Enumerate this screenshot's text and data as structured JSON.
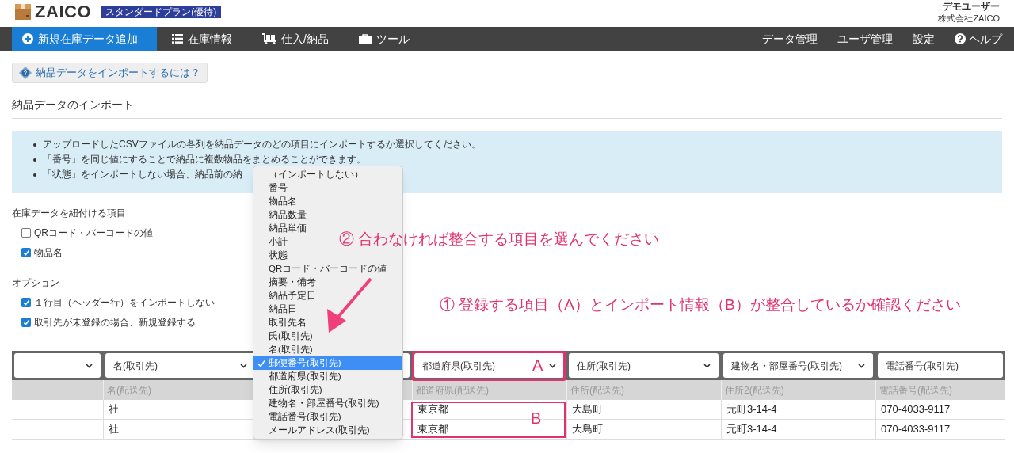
{
  "header": {
    "logo_text": "ZAICO",
    "plan_badge": "スタンダードプラン(優待)",
    "user_name": "デモユーザー",
    "company": "株式会社ZAICO"
  },
  "nav": {
    "left": [
      {
        "label": "新規在庫データ追加",
        "selected": true
      },
      {
        "label": "在庫情報",
        "selected": false
      },
      {
        "label": "仕入/納品",
        "selected": false
      },
      {
        "label": "ツール",
        "selected": false
      }
    ],
    "right": [
      {
        "label": "データ管理"
      },
      {
        "label": "ユーザ管理"
      },
      {
        "label": "設定"
      },
      {
        "label": "ヘルプ"
      }
    ]
  },
  "help_button": "納品データをインポートするには？",
  "section_title": "納品データのインポート",
  "info_bullets": [
    "アップロードしたCSVファイルの各列を納品データのどの項目にインポートするか選択してください。",
    "「番号」を同じ値にすることで納品に複数物品をまとめることができます。",
    "「状態」をインポートしない場合、納品前の納"
  ],
  "link_fields": {
    "title": "在庫データを紐付ける項目",
    "options": [
      {
        "label": "QRコード・バーコードの値",
        "checked": false
      },
      {
        "label": "物品名",
        "checked": true
      }
    ]
  },
  "options": {
    "title": "オプション",
    "options": [
      {
        "label": "１行目（ヘッダー行）をインポートしない",
        "checked": true
      },
      {
        "label": "取引先が未登録の場合、新規登録する",
        "checked": true
      }
    ]
  },
  "mapping_table": {
    "columns": [
      {
        "cells": [
          "",
          ""
        ]
      },
      {
        "select_value": "名(取引先)",
        "header": "名(配送先)",
        "cells": [
          "社",
          "社"
        ]
      },
      {
        "cells": [
          "",
          ""
        ]
      },
      {
        "select_value": "都道府県(取引先)",
        "header": "都道府県(配送先)",
        "cells": [
          "東京都",
          "東京都"
        ]
      },
      {
        "select_value": "住所(取引先)",
        "header": "住所(配送先)",
        "cells": [
          "大島町",
          "大島町"
        ]
      },
      {
        "select_value": "建物名・部屋番号(取引先)",
        "header": "住所2(配送先)",
        "cells": [
          "元町3-14-4",
          "元町3-14-4"
        ]
      },
      {
        "select_value": "電話番号(取引先)",
        "header": "電話番号(配送先)",
        "cells": [
          "070-4033-9117",
          "070-4033-9117"
        ]
      }
    ]
  },
  "dropdown": {
    "options": [
      {
        "label": "（インポートしない）",
        "selected": false
      },
      {
        "label": "番号",
        "selected": false
      },
      {
        "label": "物品名",
        "selected": false
      },
      {
        "label": "納品数量",
        "selected": false
      },
      {
        "label": "納品単価",
        "selected": false
      },
      {
        "label": "小計",
        "selected": false
      },
      {
        "label": "状態",
        "selected": false
      },
      {
        "label": "QRコード・バーコードの値",
        "selected": false
      },
      {
        "label": "摘要・備考",
        "selected": false
      },
      {
        "label": "納品予定日",
        "selected": false
      },
      {
        "label": "納品日",
        "selected": false
      },
      {
        "label": "取引先名",
        "selected": false
      },
      {
        "label": "氏(取引先)",
        "selected": false
      },
      {
        "label": "名(取引先)",
        "selected": false
      },
      {
        "label": "郵便番号(取引先)",
        "selected": true
      },
      {
        "label": "都道府県(取引先)",
        "selected": false
      },
      {
        "label": "住所(取引先)",
        "selected": false
      },
      {
        "label": "建物名・部屋番号(取引先)",
        "selected": false
      },
      {
        "label": "電話番号(取引先)",
        "selected": false
      },
      {
        "label": "メールアドレス(取引先)",
        "selected": false
      }
    ]
  },
  "annotations": {
    "step_2": "② 合わなければ整合する項目を選んでください",
    "step_1": "① 登録する項目（A）とインポート情報（B）が整合しているか確認ください",
    "box_a": "A",
    "box_b": "B"
  }
}
